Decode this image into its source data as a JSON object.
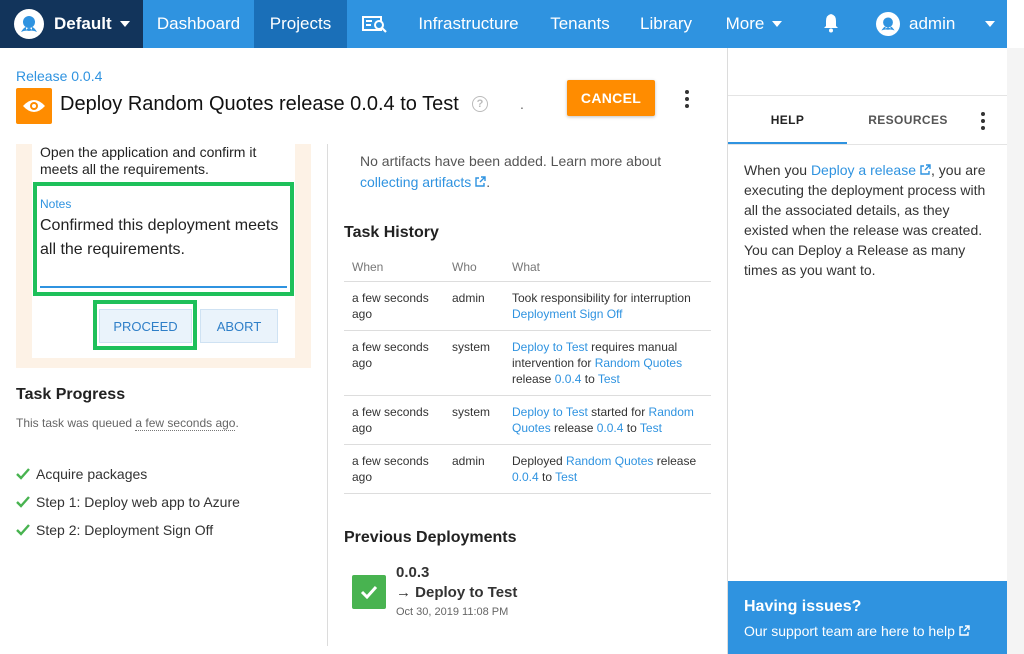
{
  "nav": {
    "space": "Default",
    "items": [
      "Dashboard",
      "Projects",
      "Infrastructure",
      "Tenants",
      "Library",
      "More"
    ],
    "active": "Projects",
    "user": "admin"
  },
  "header": {
    "breadcrumb": "Release 0.0.4",
    "title": "Deploy Random Quotes release 0.0.4 to Test",
    "dot": ".",
    "cancel_label": "CANCEL"
  },
  "intervention": {
    "instructions": "Open the application and confirm it meets all the requirements.",
    "notes_label": "Notes",
    "notes_value": "Confirmed this deployment meets all the requirements.",
    "proceed_label": "PROCEED",
    "abort_label": "ABORT"
  },
  "task_progress": {
    "heading": "Task Progress",
    "queued_prefix": "This task was queued ",
    "queued_time": "a few seconds ago",
    "queued_suffix": ".",
    "steps": [
      "Acquire packages",
      "Step 1: Deploy web app to Azure",
      "Step 2: Deployment Sign Off"
    ]
  },
  "artifacts": {
    "text": "No artifacts have been added. Learn more about ",
    "link": "collecting artifacts",
    "suffix": "."
  },
  "task_history": {
    "heading": "Task History",
    "columns": [
      "When",
      "Who",
      "What"
    ],
    "rows": [
      {
        "when": "a few seconds ago",
        "who": "admin",
        "what": [
          "Took responsibility for interruption ",
          {
            "link": "Deployment Sign Off"
          }
        ]
      },
      {
        "when": "a few seconds ago",
        "who": "system",
        "what": [
          {
            "link": "Deploy to Test"
          },
          " requires manual intervention for ",
          {
            "link": "Random Quotes"
          },
          " release ",
          {
            "link": "0.0.4"
          },
          " to ",
          {
            "link": "Test"
          }
        ]
      },
      {
        "when": "a few seconds ago",
        "who": "system",
        "what": [
          {
            "link": "Deploy to Test"
          },
          " started for ",
          {
            "link": "Random Quotes"
          },
          " release ",
          {
            "link": "0.0.4"
          },
          " to ",
          {
            "link": "Test"
          }
        ]
      },
      {
        "when": "a few seconds ago",
        "who": "admin",
        "what": [
          "Deployed ",
          {
            "link": "Random Quotes"
          },
          " release ",
          {
            "link": "0.0.4"
          },
          " to ",
          {
            "link": "Test"
          }
        ]
      }
    ]
  },
  "previous_deployments": {
    "heading": "Previous Deployments",
    "version": "0.0.3",
    "env": "→ Deploy to Test",
    "date": "Oct 30, 2019 11:08 PM"
  },
  "right_panel": {
    "tabs": [
      "HELP",
      "RESOURCES"
    ],
    "help_prefix": "When you ",
    "help_link": "Deploy a release",
    "help_suffix": ", you are executing the deployment process with all the associated details, as they existed when the release was created. You can Deploy a Release as many times as you want to.",
    "issues_heading": "Having issues?",
    "issues_text": "Our support team are here to help"
  },
  "colors": {
    "nav_blue": "#2f93e0",
    "space_navy": "#12345b",
    "accent_orange": "#ff8c00",
    "highlight_green": "#1ec05a",
    "success_green": "#48b350"
  }
}
